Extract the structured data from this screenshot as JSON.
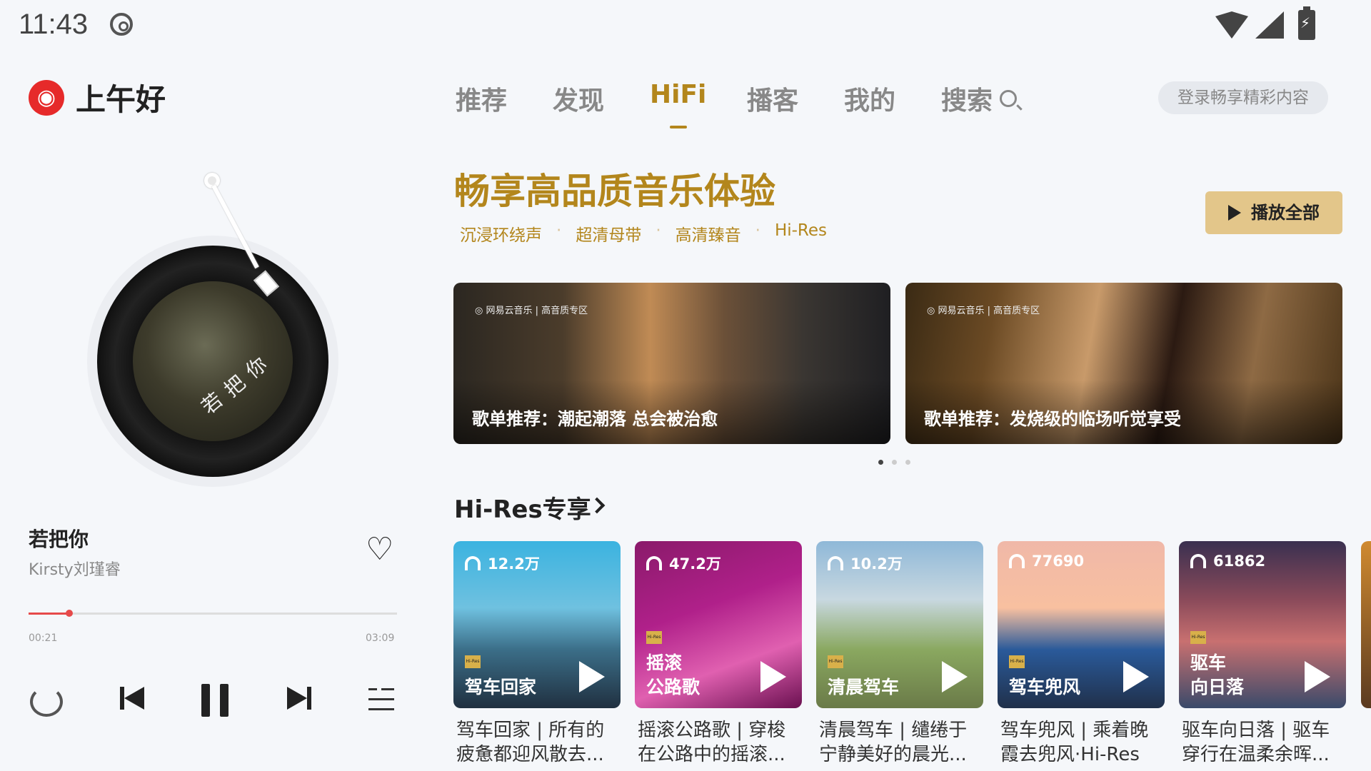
{
  "status_bar": {
    "time": "11:43"
  },
  "header": {
    "greeting": "上午好"
  },
  "nav": {
    "tabs": [
      {
        "label": "推荐",
        "active": false
      },
      {
        "label": "发现",
        "active": false
      },
      {
        "label": "HiFi",
        "active": true
      },
      {
        "label": "播客",
        "active": false
      },
      {
        "label": "我的",
        "active": false
      },
      {
        "label": "搜索",
        "active": false
      }
    ],
    "login_label": "登录畅享精彩内容"
  },
  "player": {
    "song_title": "若把你",
    "artist": "Kirsty刘瑾睿",
    "progress": 0.11,
    "time_current": "00:21",
    "time_total": "03:09",
    "disc_text": [
      "若",
      "把",
      "你"
    ]
  },
  "hero": {
    "title": "畅享高品质音乐体验",
    "tags": [
      "沉浸环绕声",
      "超清母带",
      "高清臻音",
      "Hi-Res"
    ],
    "play_all_label": "播放全部"
  },
  "banners": [
    {
      "brand": "◎ 网易云音乐 | 高音质专区",
      "caption": "歌单推荐：潮起潮落 总会被治愈"
    },
    {
      "brand": "◎ 网易云音乐 | 高音质专区",
      "caption": "歌单推荐：发烧级的临场听觉享受"
    }
  ],
  "carousel": {
    "pages": 3,
    "current": 0
  },
  "section": {
    "title": "Hi-Res专享"
  },
  "playlists": [
    {
      "count": "12.2万",
      "cover_lines": [
        "驾车回家"
      ],
      "title_lines": [
        "驾车回家 | 所有的",
        "疲惫都迎风散去..."
      ]
    },
    {
      "count": "47.2万",
      "cover_lines": [
        "摇滚",
        "公路歌"
      ],
      "title_lines": [
        "摇滚公路歌 | 穿梭",
        "在公路中的摇滚..."
      ]
    },
    {
      "count": "10.2万",
      "cover_lines": [
        "清晨驾车"
      ],
      "title_lines": [
        "清晨驾车 | 缱绻于",
        "宁静美好的晨光..."
      ]
    },
    {
      "count": "77690",
      "cover_lines": [
        "驾车兜风"
      ],
      "title_lines": [
        "驾车兜风 | 乘着晚",
        "霞去兜风·Hi-Res"
      ]
    },
    {
      "count": "61862",
      "cover_lines": [
        "驱车",
        "向日落"
      ],
      "title_lines": [
        "驱车向日落 | 驱车",
        "穿行在温柔余晖..."
      ]
    }
  ],
  "colors": {
    "accent_gold": "#b3861c",
    "play_all_bg": "#e3c68a",
    "progress_red": "#e64a4a",
    "logo_red": "#e62a2a"
  }
}
